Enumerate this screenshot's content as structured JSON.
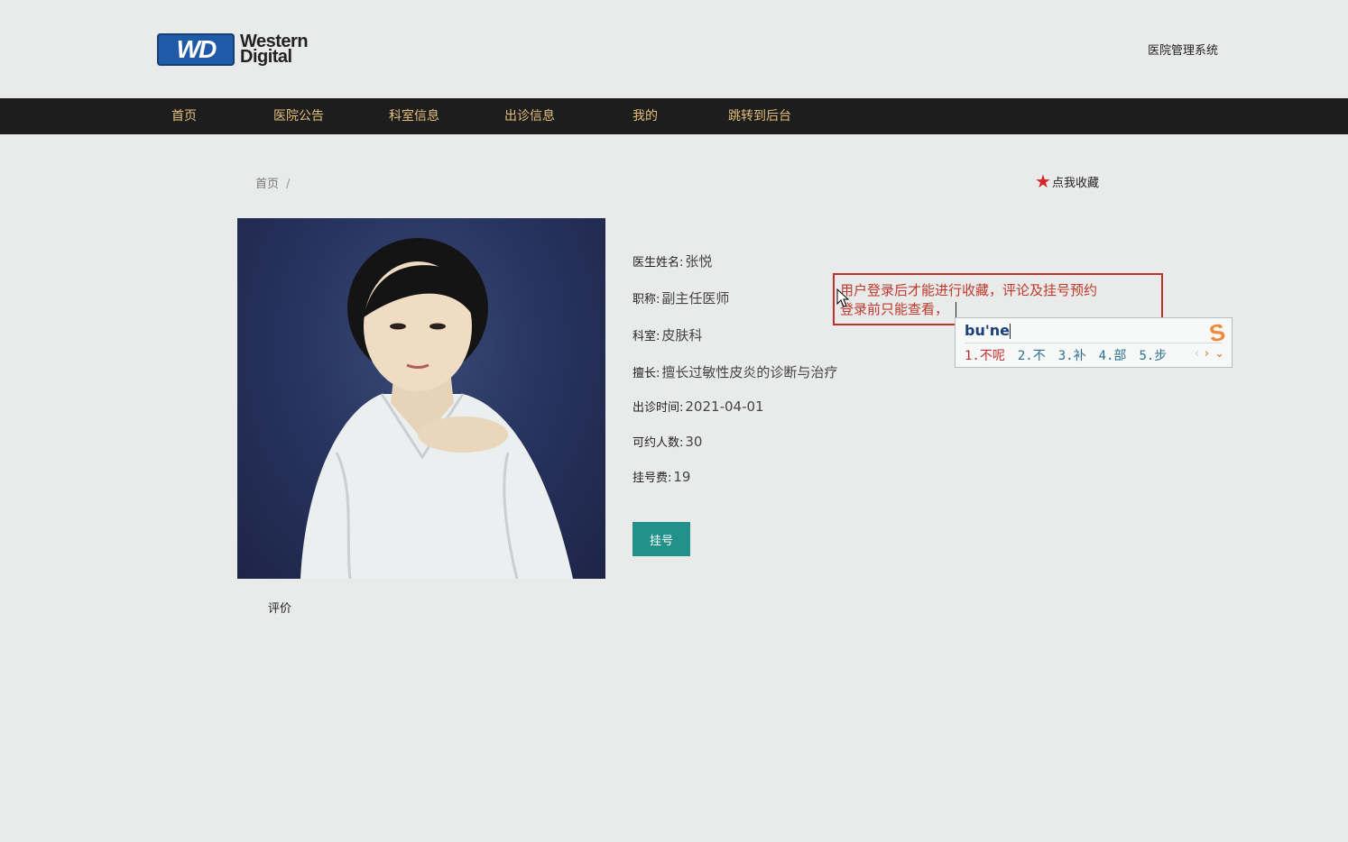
{
  "header": {
    "logo_line1": "Western",
    "logo_line2": "Digital",
    "logo_badge": "WD",
    "site_title": "医院管理系统"
  },
  "nav": {
    "items": [
      {
        "label": "首页"
      },
      {
        "label": "医院公告"
      },
      {
        "label": "科室信息"
      },
      {
        "label": "出诊信息"
      },
      {
        "label": "我的"
      },
      {
        "label": "跳转到后台"
      }
    ]
  },
  "breadcrumb": {
    "home": "首页",
    "separator": "/"
  },
  "favorite": {
    "icon": "star-icon",
    "label": "点我收藏"
  },
  "doctor": {
    "name_label": "医生姓名:",
    "name": "张悦",
    "title_label": "职称:",
    "title": "副主任医师",
    "dept_label": "科室:",
    "dept": "皮肤科",
    "specialty_label": "擅长:",
    "specialty": "擅长过敏性皮炎的诊断与治疗",
    "time_label": "出诊时间:",
    "time": "2021-04-01",
    "capacity_label": "可约人数:",
    "capacity": "30",
    "fee_label": "挂号费:",
    "fee": "19"
  },
  "register_button": "挂号",
  "review_label": "评价",
  "notice": {
    "line1": "用户登录后才能进行收藏，评论及挂号预约",
    "line2": "登录前只能查看，"
  },
  "ime": {
    "input": "bu'ne",
    "candidates": [
      "1.不呢",
      "2.不",
      "3.补",
      "4.部",
      "5.步"
    ],
    "logo": "S"
  },
  "colors": {
    "nav_bg": "#1d1d1d",
    "nav_text": "#e4bf7a",
    "button": "#22918a",
    "star": "#d8232a",
    "notice_border": "#c0312e"
  }
}
